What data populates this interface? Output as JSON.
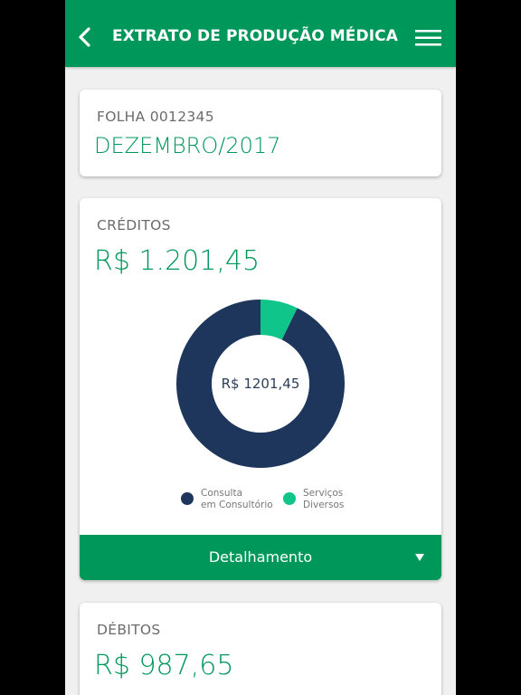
{
  "header": {
    "title": "EXTRATO DE PRODUÇÃO MÉDICA",
    "back_icon": "chevron-left-icon",
    "menu_icon": "hamburger-menu-icon",
    "color": "#00985a"
  },
  "folha": {
    "label": "FOLHA 0012345",
    "period": "DEZEMBRO/2017"
  },
  "creditos": {
    "label": "CRÉDITOS",
    "value": "R$ 1.201,45",
    "detail_button": "Detalhamento",
    "detail_icon": "caret-down-icon"
  },
  "chart_data": {
    "type": "pie",
    "center_label": "R$ 1201,45",
    "categories": [
      "Consulta\nem Consultório",
      "Serviços\nDiversos"
    ],
    "values": [
      1115.0,
      86.45
    ],
    "colors": [
      "#1f365c",
      "#0fc58a"
    ]
  },
  "debitos": {
    "label": "DÉBITOS",
    "value": "R$ 987,65"
  }
}
